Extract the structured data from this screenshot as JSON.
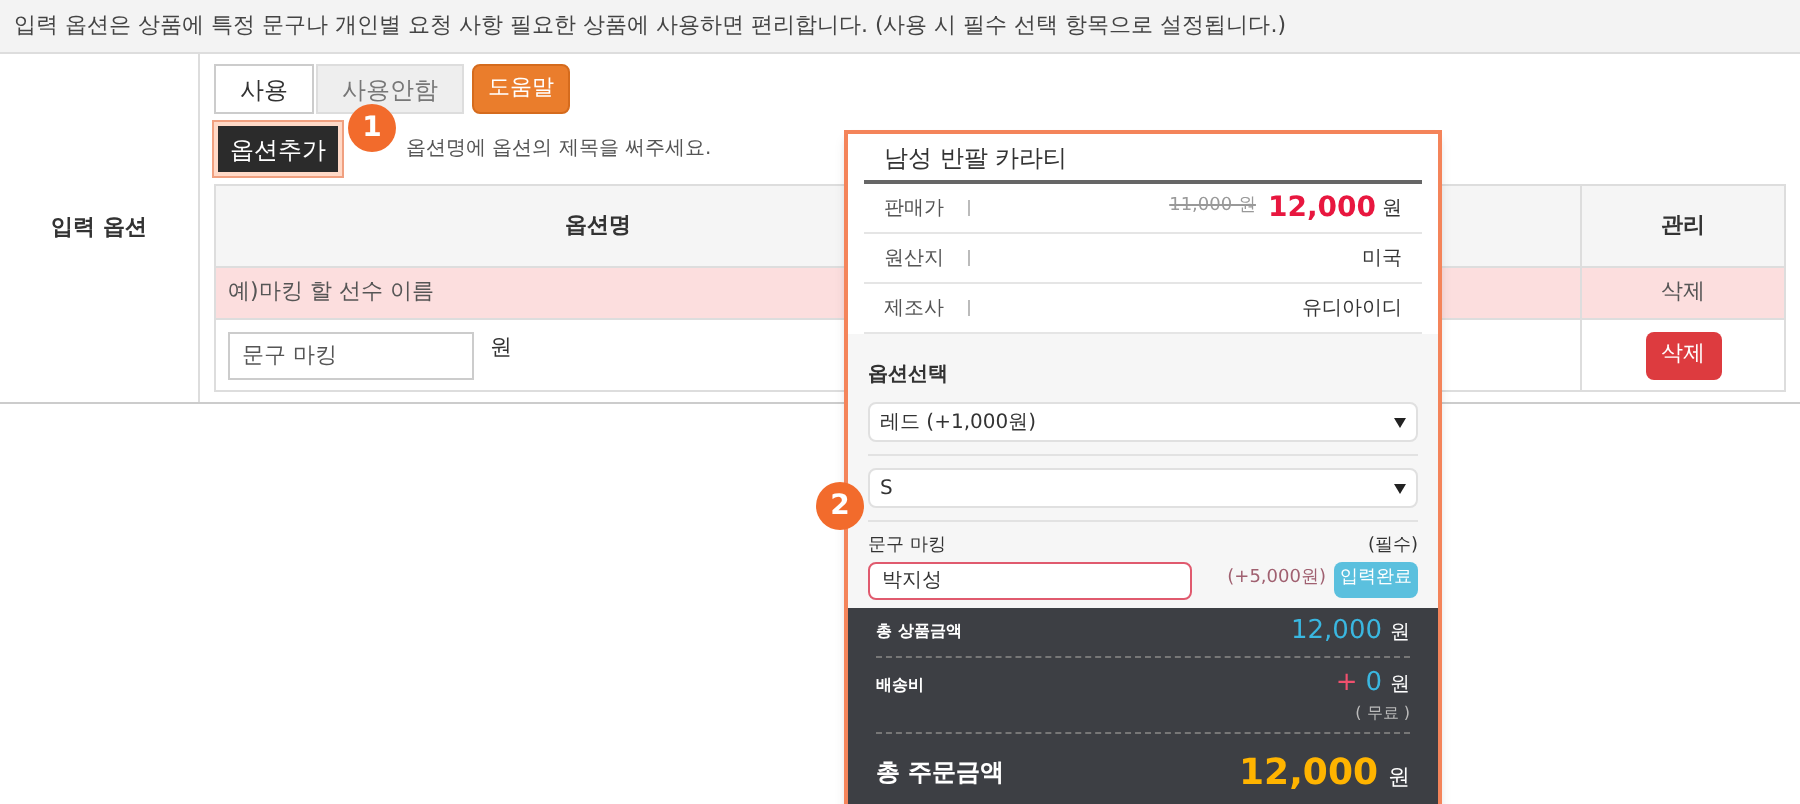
{
  "notice": "입력 옵션은 상품에 특정 문구나 개인별 요청 사항 필요한 상품에 사용하면 편리합니다. (사용 시 필수 선택 항목으로 설정됩니다.)",
  "section_label": "입력 옵션",
  "usage_tabs": [
    {
      "label": "사용",
      "selected": true
    },
    {
      "label": "사용안함",
      "selected": false
    }
  ],
  "help_button": "도움말",
  "add_option_button": "옵션추가",
  "add_option_hint": "옵션명에 옵션의 제목을 써주세요.",
  "table": {
    "columns": [
      "옵션명",
      "관리"
    ],
    "example_row": {
      "option_name": "예)마킹 할 선수 이름",
      "action": "삭제"
    },
    "rows": [
      {
        "option_name": "문구 마킹",
        "unit": "원",
        "delete_button": "삭제"
      }
    ]
  },
  "steps": [
    "1",
    "2"
  ],
  "preview": {
    "title": "남성 반팔 카라티",
    "info": [
      {
        "kind": "price",
        "label": "판매가",
        "original": "11,000 원",
        "price": "12,000",
        "unit": "원"
      },
      {
        "kind": "text",
        "label": "원산지",
        "value": "미국"
      },
      {
        "kind": "text",
        "label": "제조사",
        "value": "유디아이디"
      }
    ],
    "option_title": "옵션선택",
    "selects": [
      "레드 (+1,000원)",
      "S"
    ],
    "text_option": {
      "label": "문구 마킹",
      "required": "(필수)",
      "value": "박지성",
      "surcharge": "(+5,000원)",
      "button": "입력완료"
    },
    "summary": {
      "subtotal_label": "총 상품금액",
      "subtotal": "12,000",
      "subtotal_unit": "원",
      "shipping_label": "배송비",
      "shipping_sign": "+",
      "shipping": "0",
      "shipping_unit": "원",
      "shipping_note": "( 무료 )",
      "total_label": "총 주문금액",
      "total": "12,000",
      "total_unit": "원"
    }
  }
}
